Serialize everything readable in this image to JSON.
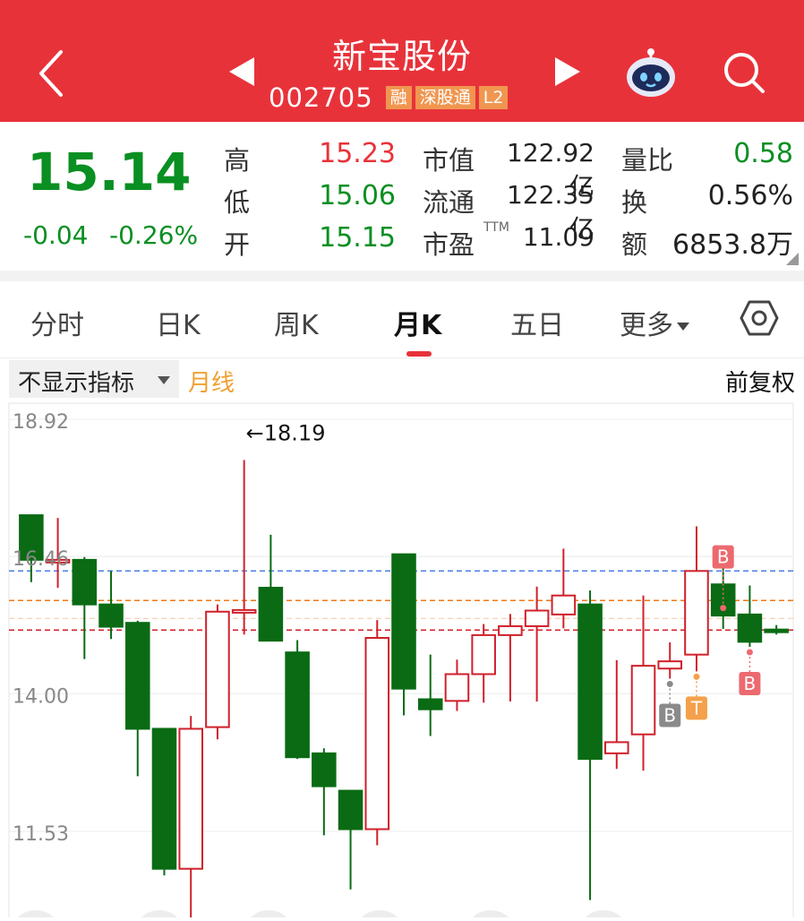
{
  "header": {
    "title": "新宝股份",
    "code": "002705",
    "tags": [
      "融",
      "深股通",
      "L2"
    ],
    "colors": {
      "bg": "#e8323a",
      "tag": "#f09650"
    }
  },
  "quote": {
    "price": "15.14",
    "change": "-0.04",
    "change_pct": "-0.26%",
    "rows": [
      {
        "label": "高",
        "value": "15.23",
        "color": "#e8323a"
      },
      {
        "label": "低",
        "value": "15.06",
        "color": "#0a8f22"
      },
      {
        "label": "开",
        "value": "15.15",
        "color": "#0a8f22"
      }
    ],
    "mid": [
      {
        "label": "市值",
        "value": "122.92亿"
      },
      {
        "label": "流通",
        "value": "122.35亿"
      },
      {
        "label": "市盈",
        "sup": "TTM",
        "value": "11.09"
      }
    ],
    "right": [
      {
        "label": "量比",
        "value": "0.58",
        "color": "#0a8f22"
      },
      {
        "label": "换",
        "value": "0.56%",
        "color": "#222"
      },
      {
        "label": "额",
        "value": "6853.8万",
        "color": "#222"
      }
    ]
  },
  "tabs": [
    "分时",
    "日K",
    "周K",
    "月K",
    "五日",
    "更多"
  ],
  "active_tab": "月K",
  "toolbar": {
    "indicator": "不显示指标",
    "line_type": "月线",
    "adjust": "前复权"
  },
  "chart_data": {
    "type": "candlestick",
    "ylim": [
      10.0,
      19.0
    ],
    "y_ticks": [
      "18.92",
      "16.46",
      "14.00",
      "11.53"
    ],
    "max_label": "←18.19",
    "up_color": "#d0202a",
    "down_color": "#0a6b14",
    "ref_lines": [
      {
        "value": 16.2,
        "color": "#4a7ee8"
      },
      {
        "value": 15.67,
        "color": "#f07a18"
      },
      {
        "value": 15.14,
        "color": "#d0202a"
      }
    ],
    "candles": [
      {
        "o": 17.2,
        "h": 17.2,
        "l": 16.0,
        "c": 16.4
      },
      {
        "o": 16.4,
        "h": 17.15,
        "l": 15.9,
        "c": 16.4
      },
      {
        "o": 16.4,
        "h": 16.45,
        "l": 14.62,
        "c": 15.6
      },
      {
        "o": 15.6,
        "h": 16.2,
        "l": 14.98,
        "c": 15.2
      },
      {
        "o": 15.27,
        "h": 15.31,
        "l": 12.52,
        "c": 13.37
      },
      {
        "o": 13.37,
        "h": 13.37,
        "l": 10.74,
        "c": 10.86
      },
      {
        "o": 10.86,
        "h": 13.6,
        "l": 9.75,
        "c": 13.37
      },
      {
        "o": 13.4,
        "h": 15.6,
        "l": 13.18,
        "c": 15.47
      },
      {
        "o": 15.46,
        "h": 18.19,
        "l": 15.06,
        "c": 15.5
      },
      {
        "o": 15.9,
        "h": 16.85,
        "l": 14.97,
        "c": 14.95
      },
      {
        "o": 14.74,
        "h": 14.96,
        "l": 12.83,
        "c": 12.86
      },
      {
        "o": 12.93,
        "h": 13.02,
        "l": 11.46,
        "c": 12.34
      },
      {
        "o": 12.26,
        "h": 12.27,
        "l": 10.49,
        "c": 11.57
      },
      {
        "o": 11.57,
        "h": 15.32,
        "l": 11.28,
        "c": 15.0
      },
      {
        "o": 16.5,
        "h": 16.5,
        "l": 13.61,
        "c": 14.09
      },
      {
        "o": 13.9,
        "h": 14.7,
        "l": 13.24,
        "c": 13.72
      },
      {
        "o": 13.87,
        "h": 14.61,
        "l": 13.69,
        "c": 14.35
      },
      {
        "o": 14.35,
        "h": 15.25,
        "l": 13.84,
        "c": 15.05
      },
      {
        "o": 15.05,
        "h": 15.43,
        "l": 13.86,
        "c": 15.21
      },
      {
        "o": 15.21,
        "h": 15.92,
        "l": 13.86,
        "c": 15.49
      },
      {
        "o": 15.42,
        "h": 16.6,
        "l": 15.17,
        "c": 15.76
      },
      {
        "o": 15.6,
        "h": 15.85,
        "l": 10.3,
        "c": 12.83
      },
      {
        "o": 12.93,
        "h": 14.6,
        "l": 12.65,
        "c": 13.13
      },
      {
        "o": 13.27,
        "h": 15.76,
        "l": 12.62,
        "c": 14.5
      },
      {
        "o": 14.45,
        "h": 14.92,
        "l": 14.27,
        "c": 14.58
      },
      {
        "o": 14.7,
        "h": 17.0,
        "l": 14.4,
        "c": 16.2
      },
      {
        "o": 15.96,
        "h": 16.5,
        "l": 15.16,
        "c": 15.4
      },
      {
        "o": 15.42,
        "h": 15.94,
        "l": 14.84,
        "c": 14.93
      },
      {
        "o": 15.15,
        "h": 15.23,
        "l": 15.06,
        "c": 15.14
      }
    ],
    "markers": [
      {
        "index": 24,
        "label": "B",
        "color": "#8a8a8a",
        "position": "below"
      },
      {
        "index": 25,
        "label": "T",
        "color": "#f5a04a",
        "position": "below"
      },
      {
        "index": 26,
        "label": "B",
        "color": "#ec6a6f",
        "position": "above"
      },
      {
        "index": 27,
        "label": "B",
        "color": "#ec6a6f",
        "position": "below"
      }
    ]
  }
}
